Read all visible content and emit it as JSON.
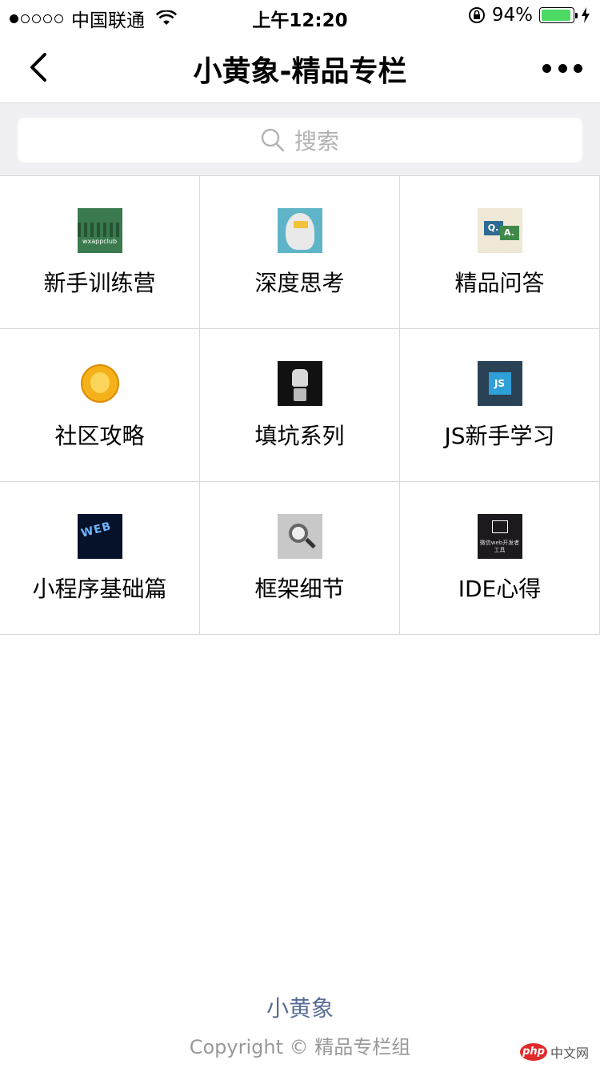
{
  "status_bar": {
    "carrier": "中国联通",
    "time": "上午12:20",
    "battery": "94%",
    "battery_level": 0.94,
    "signal_bars_filled": 1,
    "signal_bars_total": 5,
    "icons": [
      "wifi-icon",
      "lock-rotation-icon",
      "battery-icon",
      "charging-bolt-icon"
    ]
  },
  "nav": {
    "title": "小黄象-精品专栏",
    "back_icon": "chevron-left-icon",
    "more_icon": "more-dots-icon"
  },
  "search": {
    "placeholder": "搜索",
    "icon": "search-icon"
  },
  "grid": {
    "items": [
      {
        "label": "新手训练营",
        "thumb": "wxappclub",
        "thumb_text": "wxappclub"
      },
      {
        "label": "深度思考",
        "thumb": "ideas-head"
      },
      {
        "label": "精品问答",
        "thumb": "qa",
        "q": "Q.",
        "a": "A."
      },
      {
        "label": "社区攻略",
        "thumb": "elephant"
      },
      {
        "label": "填坑系列",
        "thumb": "robot"
      },
      {
        "label": "JS新手学习",
        "thumb": "js",
        "thumb_text": "JS"
      },
      {
        "label": "小程序基础篇",
        "thumb": "web-development",
        "thumb_text": "WEB"
      },
      {
        "label": "框架细节",
        "thumb": "magnifier"
      },
      {
        "label": "IDE心得",
        "thumb": "ide",
        "thumb_text": "微信web开发者工具"
      }
    ]
  },
  "footer": {
    "link": "小黄象",
    "copyright": "Copyright © 精品专栏组"
  },
  "watermark": {
    "brand": "php",
    "text": "中文网"
  },
  "colors": {
    "battery_fill": "#4cd964",
    "footer_link": "#586c94",
    "search_bg": "#efeff4"
  }
}
